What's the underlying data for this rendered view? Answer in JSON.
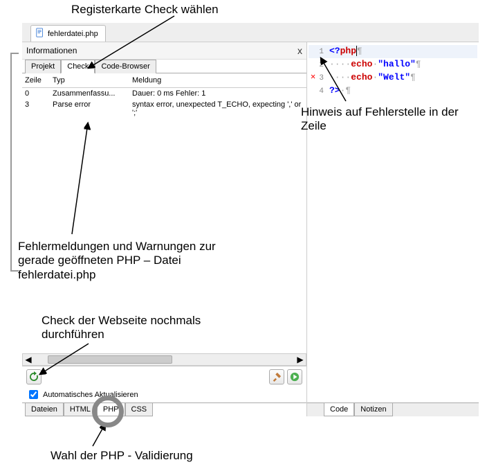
{
  "annotations": {
    "top": "Registerkarte Check wählen",
    "hint": "Hinweis auf Fehlerstelle in der\nZeile",
    "errors": "Fehlermeldungen und Warnungen zur gerade geöffneten PHP – Datei fehlerdatei.php",
    "recheck": "Check der Webseite nochmals durchführen",
    "phpval": "Wahl der PHP - Validierung"
  },
  "file_tab": "fehlerdatei.php",
  "info_panel": {
    "title": "Informationen",
    "close": "x",
    "tabs": [
      "Projekt",
      "Check",
      "Code-Browser"
    ],
    "active_tab": 1,
    "columns": {
      "zeile": "Zeile",
      "typ": "Typ",
      "meldung": "Meldung"
    },
    "rows": [
      {
        "zeile": "0",
        "typ": "Zusammenfassu...",
        "meldung": "Dauer: 0 ms  Fehler: 1"
      },
      {
        "zeile": "3",
        "typ": "Parse error",
        "meldung": "syntax error, unexpected T_ECHO, expecting ',' or ';'"
      }
    ],
    "auto_update": "Automatisches Aktualisieren",
    "auto_update_checked": true,
    "bottom_tabs": [
      "Dateien",
      "HTML",
      "PHP",
      "CSS"
    ],
    "bottom_active": 2
  },
  "editor": {
    "right_tabs": [
      "Code",
      "Notizen"
    ],
    "right_active": 0,
    "lines": [
      {
        "n": 1,
        "raw": "<?php¶",
        "hl": true
      },
      {
        "n": 2,
        "raw": "····echo·\"hallo\"¶"
      },
      {
        "n": 3,
        "raw": "····echo·\"Welt\"¶",
        "marker": "×"
      },
      {
        "n": 4,
        "raw": "?>·¶"
      }
    ]
  }
}
